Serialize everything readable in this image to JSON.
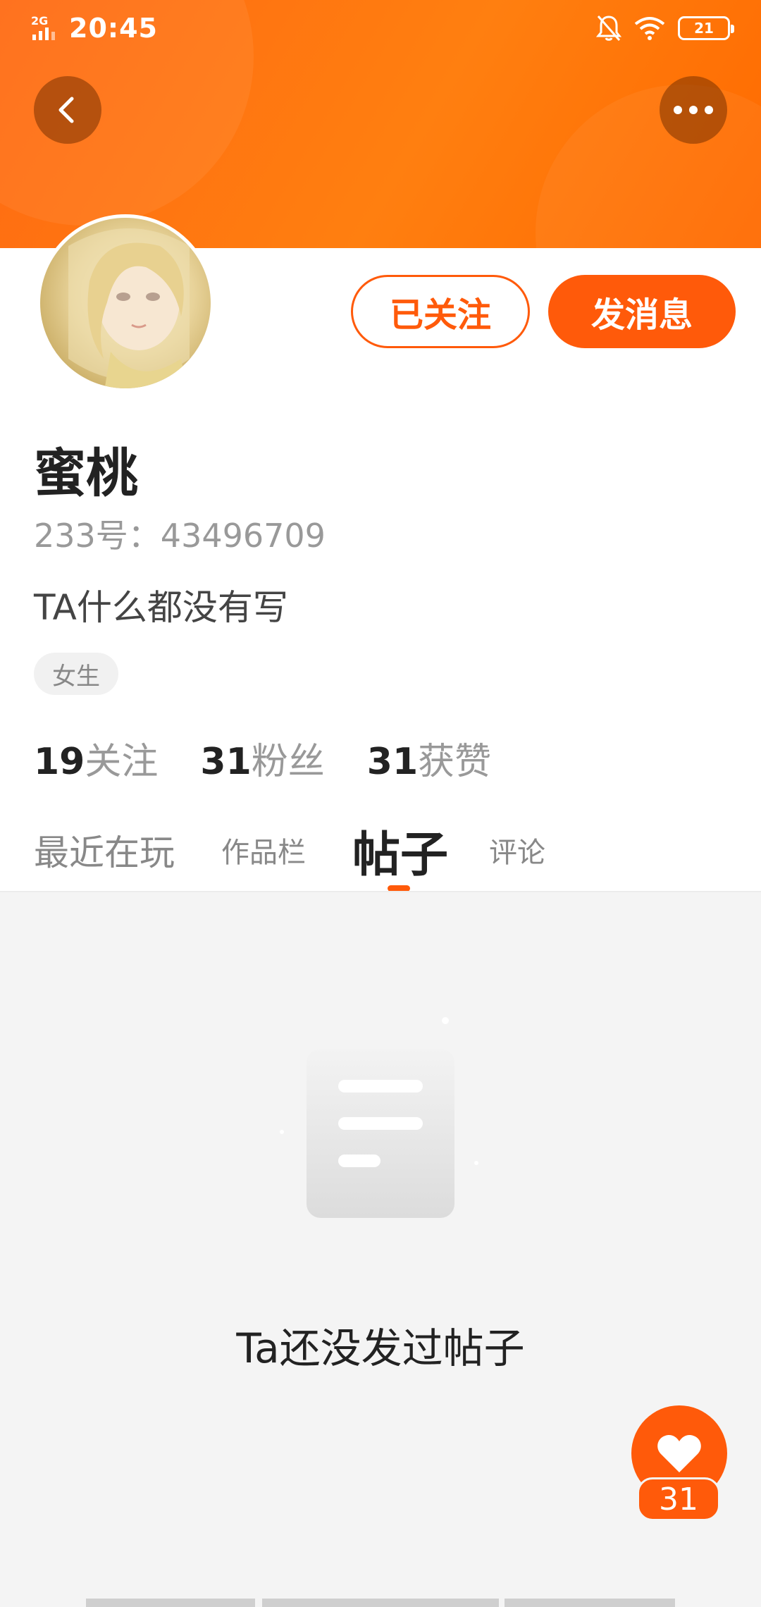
{
  "status_bar": {
    "network": "2G",
    "time": "20:45",
    "battery": "21"
  },
  "header": {
    "back_icon": "chevron-left-icon",
    "more_icon": "more-horizontal-icon"
  },
  "profile": {
    "name": "蜜桃",
    "id_line": "233号：43496709",
    "bio": "TA什么都没有写",
    "tag": "女生",
    "follow_button": "已关注",
    "message_button": "发消息"
  },
  "stats": [
    {
      "num": "19",
      "label": "关注"
    },
    {
      "num": "31",
      "label": "粉丝"
    },
    {
      "num": "31",
      "label": "获赞"
    }
  ],
  "tabs": {
    "recent": "最近在玩",
    "works": "作品栏",
    "posts": "帖子",
    "comments": "评论",
    "active": "帖子"
  },
  "empty_state": {
    "icon": "document-icon",
    "text": "Ta还没发过帖子"
  },
  "like": {
    "count": "31"
  },
  "colors": {
    "accent": "#ff5a0a",
    "header": "#ff7a10"
  }
}
